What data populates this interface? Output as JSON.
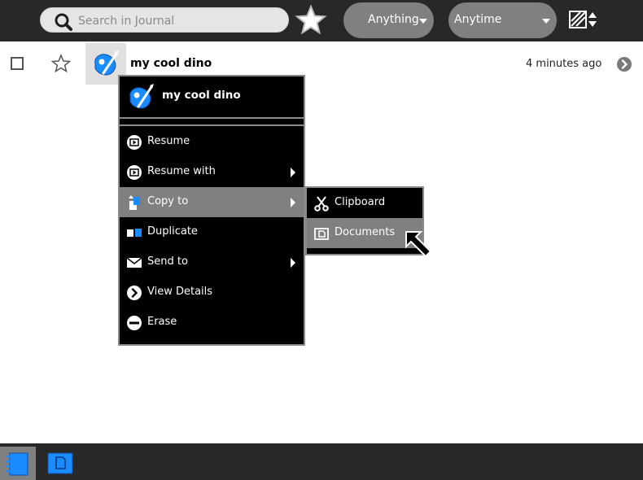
{
  "toolbar": {
    "search": {
      "placeholder": "Search in Journal",
      "value": ""
    },
    "favorite_filter_icon": "star-icon",
    "what_filter": {
      "label": "Anything"
    },
    "when_filter": {
      "label": "Anytime"
    },
    "sort_icon": "sort-icon"
  },
  "entry": {
    "title": "my cool dino",
    "time": "4 minutes ago",
    "activity_icon": "paint-activity-icon"
  },
  "palette": {
    "title": "my cool dino",
    "items": [
      {
        "label": "Resume",
        "icon": "resume-icon",
        "has_submenu": false
      },
      {
        "label": "Resume with",
        "icon": "resume-icon",
        "has_submenu": true
      },
      {
        "label": "Copy to",
        "icon": "copy-icon",
        "has_submenu": true,
        "highlighted": true
      },
      {
        "label": "Duplicate",
        "icon": "duplicate-icon",
        "has_submenu": false
      },
      {
        "label": "Send to",
        "icon": "mail-icon",
        "has_submenu": true
      },
      {
        "label": "View Details",
        "icon": "details-icon",
        "has_submenu": false
      },
      {
        "label": "Erase",
        "icon": "erase-icon",
        "has_submenu": false
      }
    ]
  },
  "copy_submenu": {
    "items": [
      {
        "label": "Clipboard",
        "icon": "scissors-icon"
      },
      {
        "label": "Documents",
        "icon": "documents-icon",
        "highlighted": true
      }
    ]
  },
  "frame": {
    "items": [
      {
        "icon": "journal-icon",
        "active": true
      },
      {
        "icon": "documents-volume-icon",
        "active": false
      }
    ]
  },
  "colors": {
    "toolbar_bg": "#282828",
    "highlight": "#808080",
    "activity_blue": "#1a8cff",
    "palette_bg": "#000000"
  }
}
